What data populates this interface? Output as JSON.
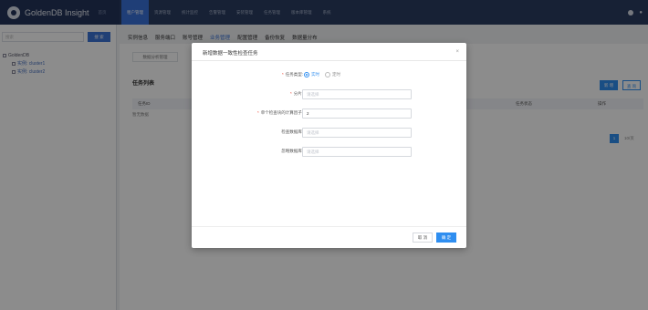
{
  "app": {
    "name": "GoldenDB Insight",
    "sub": "首页"
  },
  "nav": [
    "租户管理",
    "资源管理",
    "统计监控",
    "告警管理",
    "安装管理",
    "任务管理",
    "版本库管理",
    "系统"
  ],
  "sidebar": {
    "search_placeholder": "搜索",
    "search_button": "搜 索",
    "tree": [
      {
        "label": "GoldenDB",
        "level": 0
      },
      {
        "label": "实例: cluster1",
        "level": 1
      },
      {
        "label": "实例: cluster2",
        "level": 1
      }
    ]
  },
  "main_tabs": [
    "实例信息",
    "服务端口",
    "账号管理",
    "业务管理",
    "配置管理",
    "备份恢复",
    "数据量分布"
  ],
  "content": {
    "sub_tab": "数据分析管理",
    "section_title": "任务列表",
    "btn_add": "新 增",
    "btn_query": "查 询",
    "table_headers": [
      "任务ID",
      "任务状态",
      "操作"
    ],
    "row_text": "暂无数据",
    "page": "1",
    "page_info": "10/页"
  },
  "modal": {
    "title": "新增数据一致性检查任务",
    "task_type_label": "任务类型:",
    "task_type_options": [
      "实时",
      "定时"
    ],
    "selected_option": "实时",
    "shard_label": "分片:",
    "shard_placeholder": "请选择",
    "factor_label": "单个检查块的计算因子:",
    "factor_value": "2",
    "check_db_label": "检查数据库:",
    "check_db_placeholder": "请选择",
    "skip_db_label": "忽略数据库:",
    "skip_db_placeholder": "请选择",
    "cancel": "取 消",
    "ok": "确 定"
  }
}
